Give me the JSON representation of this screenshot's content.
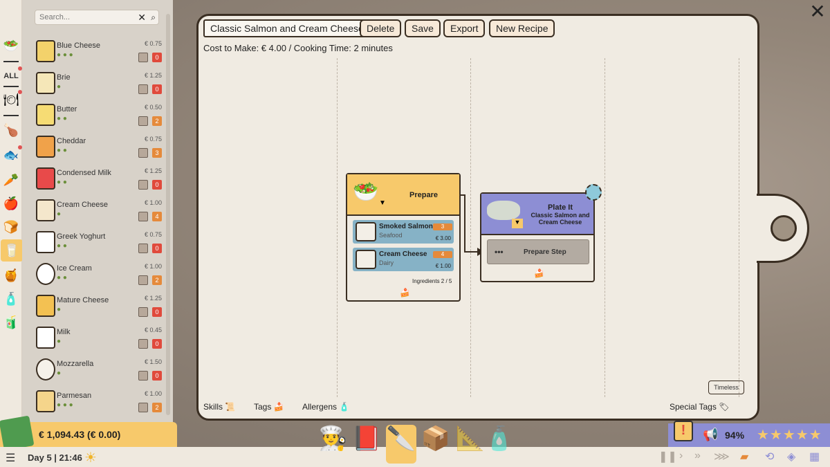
{
  "search": {
    "placeholder": "Search..."
  },
  "rail": {
    "all_label": "ALL"
  },
  "ingredients": [
    {
      "name": "Blue Cheese",
      "price": "€ 0.75",
      "qty": "0"
    },
    {
      "name": "Brie",
      "price": "€ 1.25",
      "qty": "0"
    },
    {
      "name": "Butter",
      "price": "€ 0.50",
      "qty": "2"
    },
    {
      "name": "Cheddar",
      "price": "€ 0.75",
      "qty": "3"
    },
    {
      "name": "Condensed Milk",
      "price": "€ 1.25",
      "qty": "0"
    },
    {
      "name": "Cream Cheese",
      "price": "€ 1.00",
      "qty": "4"
    },
    {
      "name": "Greek Yoghurt",
      "price": "€ 0.75",
      "qty": "0"
    },
    {
      "name": "Ice Cream",
      "price": "€ 1.00",
      "qty": "2"
    },
    {
      "name": "Mature Cheese",
      "price": "€ 1.25",
      "qty": "0"
    },
    {
      "name": "Milk",
      "price": "€ 0.45",
      "qty": "0"
    },
    {
      "name": "Mozzarella",
      "price": "€ 1.50",
      "qty": "0"
    },
    {
      "name": "Parmesan",
      "price": "€ 1.00",
      "qty": "2"
    }
  ],
  "money": {
    "amount": "€ 1,094.43 (€ 0.00)"
  },
  "daybar": {
    "day": "Day 5 | 21:46"
  },
  "status": {
    "percent": "94%",
    "stars": "★★★★★",
    "alert": "!"
  },
  "recipe": {
    "name": "Classic Salmon and Cream Cheese",
    "buttons": {
      "delete": "Delete",
      "save": "Save",
      "export": "Export",
      "new": "New Recipe"
    },
    "cost_line": "Cost to Make: € 4.00 / Cooking Time: 2 minutes",
    "prepare": {
      "title": "Prepare",
      "ingredients": [
        {
          "name": "Smoked Salmon",
          "category": "Seafood",
          "count": "3",
          "price": "€ 3.00"
        },
        {
          "name": "Cream Cheese",
          "category": "Dairy",
          "count": "4",
          "price": "€ 1.00"
        }
      ],
      "ingredient_count": "Ingredients  2 / 5"
    },
    "plate": {
      "title": "Plate It",
      "subtitle": "Classic Salmon and Cream Cheese",
      "step_label": "Prepare Step",
      "step_dots": "•••"
    },
    "bottom": {
      "skills": "Skills",
      "tags": "Tags",
      "allergens": "Allergens",
      "special_tags": "Special Tags",
      "timeless": "Timeless"
    }
  },
  "close": "✕",
  "colors": {
    "accent_yellow": "#f7c96b",
    "plate_purple": "#8d8ed4",
    "ingredient_blue": "#86b2c6",
    "qty_red": "#e04a3c",
    "qty_orange": "#e58a3b"
  }
}
